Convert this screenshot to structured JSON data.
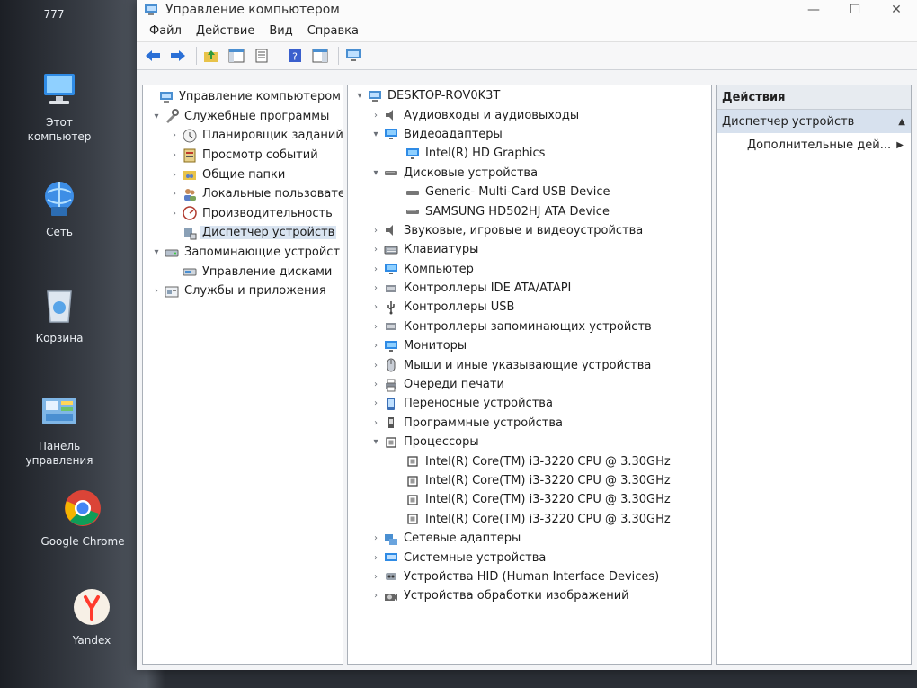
{
  "desktop": {
    "icons": [
      {
        "label": "777"
      },
      {
        "label": "Этот компьютер"
      },
      {
        "label": "Сеть"
      },
      {
        "label": "Корзина"
      },
      {
        "label": "Панель управления"
      },
      {
        "label": "Google Chrome"
      },
      {
        "label": "Yandex"
      }
    ]
  },
  "window": {
    "title": "Управление компьютером",
    "controls": {
      "minimize": "—",
      "maximize": "☐",
      "close": "✕"
    },
    "menu": [
      "Файл",
      "Действие",
      "Вид",
      "Справка"
    ]
  },
  "left_tree": [
    {
      "label": "Управление компьютером (л",
      "arrow": "",
      "depth": 0
    },
    {
      "label": "Служебные программы",
      "arrow": "▾",
      "depth": 1
    },
    {
      "label": "Планировщик заданий",
      "arrow": "›",
      "depth": 2
    },
    {
      "label": "Просмотр событий",
      "arrow": "›",
      "depth": 2
    },
    {
      "label": "Общие папки",
      "arrow": "›",
      "depth": 2
    },
    {
      "label": "Локальные пользовате",
      "arrow": "›",
      "depth": 2
    },
    {
      "label": "Производительность",
      "arrow": "›",
      "depth": 2
    },
    {
      "label": "Диспетчер устройств",
      "arrow": "",
      "depth": 2,
      "selected": true
    },
    {
      "label": "Запоминающие устройст",
      "arrow": "▾",
      "depth": 1
    },
    {
      "label": "Управление дисками",
      "arrow": "",
      "depth": 2
    },
    {
      "label": "Службы и приложения",
      "arrow": "›",
      "depth": 1
    }
  ],
  "device_tree": [
    {
      "label": "DESKTOP-ROV0K3T",
      "arrow": "▾",
      "depth": 0,
      "icon": "computer-icon"
    },
    {
      "label": "Аудиовходы и аудиовыходы",
      "arrow": "›",
      "depth": 1,
      "icon": "speaker-icon"
    },
    {
      "label": "Видеоадаптеры",
      "arrow": "▾",
      "depth": 1,
      "icon": "monitor-icon"
    },
    {
      "label": "Intel(R) HD Graphics",
      "arrow": "",
      "depth": 2,
      "icon": "monitor-icon"
    },
    {
      "label": "Дисковые устройства",
      "arrow": "▾",
      "depth": 1,
      "icon": "disk-icon"
    },
    {
      "label": "Generic- Multi-Card USB Device",
      "arrow": "",
      "depth": 2,
      "icon": "disk-icon"
    },
    {
      "label": "SAMSUNG HD502HJ ATA Device",
      "arrow": "",
      "depth": 2,
      "icon": "disk-icon"
    },
    {
      "label": "Звуковые, игровые и видеоустройства",
      "arrow": "›",
      "depth": 1,
      "icon": "speaker-icon"
    },
    {
      "label": "Клавиатуры",
      "arrow": "›",
      "depth": 1,
      "icon": "keyboard-icon"
    },
    {
      "label": "Компьютер",
      "arrow": "›",
      "depth": 1,
      "icon": "monitor-icon"
    },
    {
      "label": "Контроллеры IDE ATA/ATAPI",
      "arrow": "›",
      "depth": 1,
      "icon": "controller-icon"
    },
    {
      "label": "Контроллеры USB",
      "arrow": "›",
      "depth": 1,
      "icon": "usb-icon"
    },
    {
      "label": "Контроллеры запоминающих устройств",
      "arrow": "›",
      "depth": 1,
      "icon": "controller-icon"
    },
    {
      "label": "Мониторы",
      "arrow": "›",
      "depth": 1,
      "icon": "monitor-icon"
    },
    {
      "label": "Мыши и иные указывающие устройства",
      "arrow": "›",
      "depth": 1,
      "icon": "mouse-icon"
    },
    {
      "label": "Очереди печати",
      "arrow": "›",
      "depth": 1,
      "icon": "printer-icon"
    },
    {
      "label": "Переносные устройства",
      "arrow": "›",
      "depth": 1,
      "icon": "portable-device-icon"
    },
    {
      "label": "Программные устройства",
      "arrow": "›",
      "depth": 1,
      "icon": "software-device-icon"
    },
    {
      "label": "Процессоры",
      "arrow": "▾",
      "depth": 1,
      "icon": "processor-icon"
    },
    {
      "label": "Intel(R) Core(TM) i3-3220 CPU @ 3.30GHz",
      "arrow": "",
      "depth": 2,
      "icon": "processor-icon"
    },
    {
      "label": "Intel(R) Core(TM) i3-3220 CPU @ 3.30GHz",
      "arrow": "",
      "depth": 2,
      "icon": "processor-icon"
    },
    {
      "label": "Intel(R) Core(TM) i3-3220 CPU @ 3.30GHz",
      "arrow": "",
      "depth": 2,
      "icon": "processor-icon"
    },
    {
      "label": "Intel(R) Core(TM) i3-3220 CPU @ 3.30GHz",
      "arrow": "",
      "depth": 2,
      "icon": "processor-icon"
    },
    {
      "label": "Сетевые адаптеры",
      "arrow": "›",
      "depth": 1,
      "icon": "network-icon"
    },
    {
      "label": "Системные устройства",
      "arrow": "›",
      "depth": 1,
      "icon": "system-device-icon"
    },
    {
      "label": "Устройства HID (Human Interface Devices)",
      "arrow": "›",
      "depth": 1,
      "icon": "hid-icon"
    },
    {
      "label": "Устройства обработки изображений",
      "arrow": "›",
      "depth": 1,
      "icon": "camera-icon"
    }
  ],
  "actions": {
    "header": "Действия",
    "section": "Диспетчер устройств",
    "items": [
      "Дополнительные дей..."
    ]
  }
}
